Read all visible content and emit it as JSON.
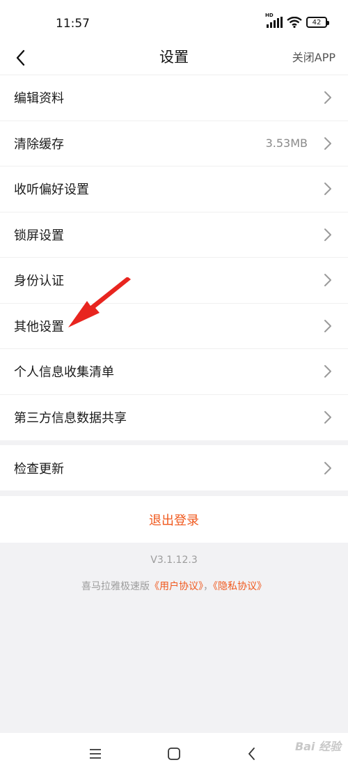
{
  "status_bar": {
    "time": "11:57",
    "signal_label": "HD",
    "battery": "42"
  },
  "header": {
    "title": "设置",
    "close_app": "关闭APP",
    "back_icon": "back-arrow-icon"
  },
  "menu": {
    "items": [
      {
        "label": "编辑资料",
        "value": ""
      },
      {
        "label": "清除缓存",
        "value": "3.53MB"
      },
      {
        "label": "收听偏好设置",
        "value": ""
      },
      {
        "label": "锁屏设置",
        "value": ""
      },
      {
        "label": "身份认证",
        "value": ""
      },
      {
        "label": "其他设置",
        "value": ""
      },
      {
        "label": "个人信息收集清单",
        "value": ""
      },
      {
        "label": "第三方信息数据共享",
        "value": ""
      }
    ],
    "check_update": "检查更新",
    "chevron_icon": "chevron-right-icon"
  },
  "logout": {
    "label": "退出登录"
  },
  "footer": {
    "version": "V3.1.12.3",
    "app_name": "喜马拉雅极速版",
    "user_agreement": "《用户协议》",
    "separator": "，",
    "privacy_agreement": "《隐私协议》"
  },
  "system_nav": {
    "menu_icon": "menu-icon",
    "home_icon": "home-square-icon",
    "back_icon": "back-icon"
  },
  "colors": {
    "accent": "#f0591e",
    "annotation": "#e8251f",
    "background": "#f2f2f4"
  },
  "watermark": "Bai 经验"
}
